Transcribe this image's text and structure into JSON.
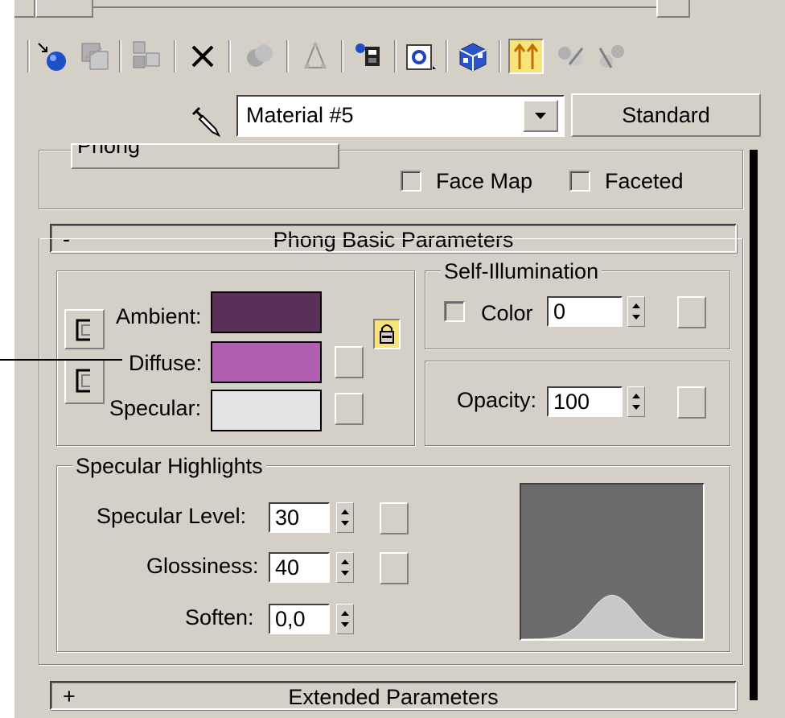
{
  "toolbar": {
    "icons": [
      "get-material-icon",
      "put-to-scene-icon",
      "assign-to-selection-icon",
      "reset-map-icon",
      "make-unique-icon",
      "put-to-library-icon",
      "material-effects-channel-icon",
      "show-map-in-viewport-icon",
      "show-end-result-icon",
      "go-to-parent-icon",
      "go-forward-to-sibling-icon"
    ],
    "material_name": "Material #5",
    "material_type": "Standard"
  },
  "shader": {
    "type": "Phong",
    "face_map_label": "Face Map",
    "faceted_label": "Faceted",
    "face_map_checked": false,
    "faceted_checked": false
  },
  "basic_params": {
    "rollout_sign": "-",
    "title": "Phong Basic Parameters",
    "ambient_label": "Ambient:",
    "diffuse_label": "Diffuse:",
    "specular_label": "Specular:",
    "ambient_color": "#5a2f58",
    "diffuse_color": "#b15fb0",
    "specular_color": "#e4e4e6",
    "self_illum": {
      "title": "Self-Illumination",
      "color_label": "Color",
      "color_checked": false,
      "value": "0"
    },
    "opacity_label": "Opacity:",
    "opacity_value": "100"
  },
  "highlights": {
    "title": "Specular Highlights",
    "level_label": "Specular Level:",
    "level_value": "30",
    "gloss_label": "Glossiness:",
    "gloss_value": "40",
    "soften_label": "Soften:",
    "soften_value": "0,0",
    "curve_bg": "#6b6b6b",
    "curve_fill": "#c8c8c8"
  },
  "extended": {
    "rollout_sign": "+",
    "title": "Extended Parameters"
  },
  "colors": {
    "panel_bg": "#d4d0c8",
    "toggle_active": "#f7e37a"
  }
}
